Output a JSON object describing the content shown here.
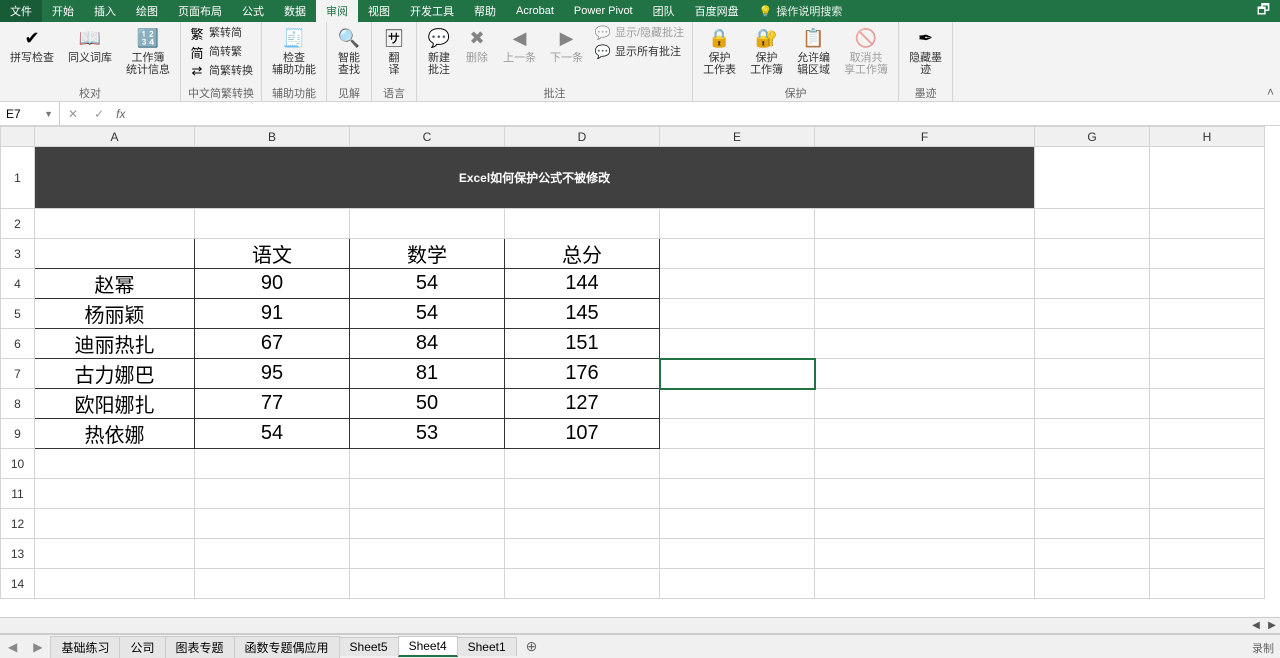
{
  "menu": {
    "file": "文件",
    "tabs": [
      "开始",
      "插入",
      "绘图",
      "页面布局",
      "公式",
      "数据",
      "审阅",
      "视图",
      "开发工具",
      "帮助",
      "Acrobat",
      "Power Pivot",
      "团队",
      "百度网盘"
    ],
    "active": "审阅",
    "search": "操作说明搜索"
  },
  "ribbon": {
    "groups": {
      "proof": {
        "label": "校对",
        "spellcheck": "拼写检查",
        "thesaurus": "同义词库",
        "stats": "工作簿\n统计信息"
      },
      "cn": {
        "label": "中文简繁转换",
        "s1": "繁转简",
        "s2": "简转繁",
        "s3": "简繁转换"
      },
      "access": {
        "label": "辅助功能",
        "check": "检查\n辅助功能"
      },
      "insight": {
        "label": "见解",
        "smart": "智能\n查找"
      },
      "lang": {
        "label": "语言",
        "translate": "翻\n译"
      },
      "comment": {
        "label": "批注",
        "new": "新建\n批注",
        "del": "删除",
        "prev": "上一条",
        "next": "下一条",
        "show1": "显示/隐藏批注",
        "show2": "显示所有批注"
      },
      "protect": {
        "label": "保护",
        "sheet": "保护\n工作表",
        "book": "保护\n工作簿",
        "edit": "允许编\n辑区域",
        "share": "取消共\n享工作簿"
      },
      "ink": {
        "label": "墨迹",
        "hide": "隐藏墨\n迹"
      }
    }
  },
  "formula_bar": {
    "name_box": "E7",
    "fx": "fx",
    "value": ""
  },
  "sheet": {
    "columns": [
      "A",
      "B",
      "C",
      "D",
      "E",
      "F",
      "G",
      "H"
    ],
    "title": "Excel如何保护公式不被修改",
    "headers": [
      "",
      "语文",
      "数学",
      "总分"
    ],
    "rows": [
      {
        "name": "赵幂",
        "c1": "90",
        "c2": "54",
        "c3": "144"
      },
      {
        "name": "杨丽颖",
        "c1": "91",
        "c2": "54",
        "c3": "145"
      },
      {
        "name": "迪丽热扎",
        "c1": "67",
        "c2": "84",
        "c3": "151"
      },
      {
        "name": "古力娜巴",
        "c1": "95",
        "c2": "81",
        "c3": "176"
      },
      {
        "name": "欧阳娜扎",
        "c1": "77",
        "c2": "50",
        "c3": "127"
      },
      {
        "name": "热依娜",
        "c1": "54",
        "c2": "53",
        "c3": "107"
      }
    ],
    "row_numbers": [
      "1",
      "2",
      "3",
      "4",
      "5",
      "6",
      "7",
      "8",
      "9",
      "10",
      "11",
      "12",
      "13",
      "14"
    ]
  },
  "tabs": {
    "list": [
      "基础练习",
      "公司",
      "图表专题",
      "函数专题偶应用",
      "Sheet5",
      "Sheet4",
      "Sheet1"
    ],
    "active": "Sheet4"
  },
  "status": "录制"
}
